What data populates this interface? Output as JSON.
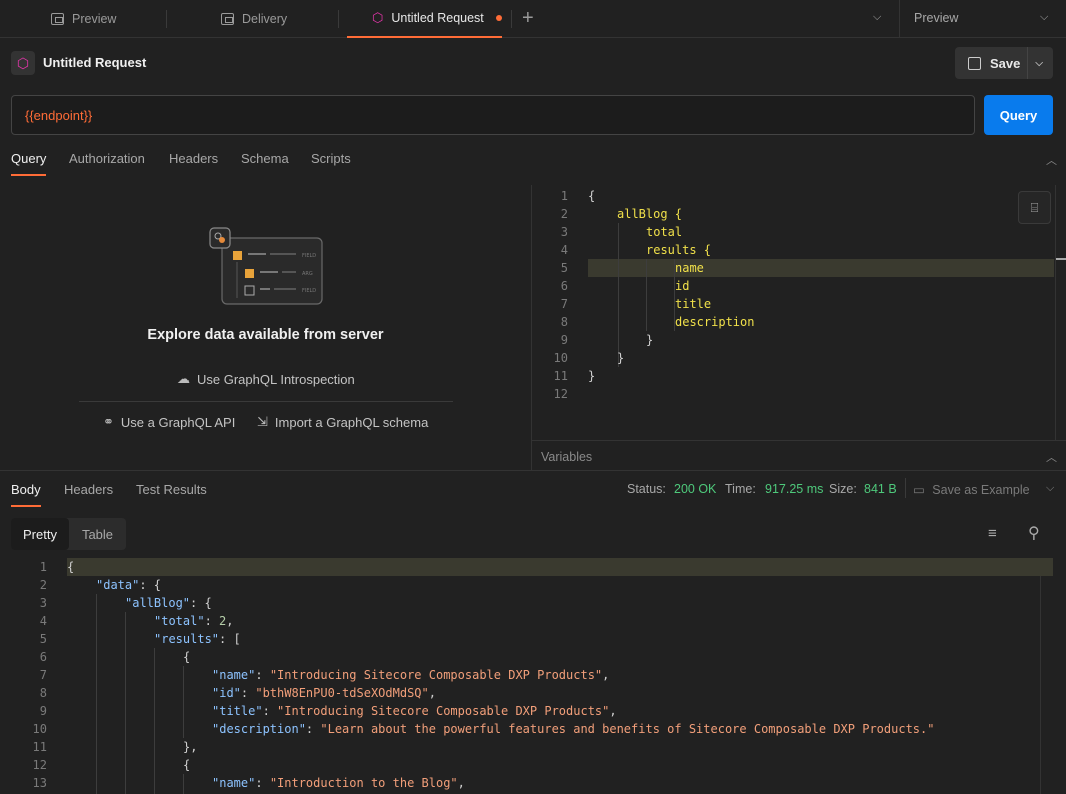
{
  "tabs": [
    {
      "label": "Preview",
      "icon": "request-icon"
    },
    {
      "label": "Delivery",
      "icon": "request-icon"
    },
    {
      "label": "Untitled Request",
      "icon": "graphql-icon",
      "active": true,
      "unsaved": true
    }
  ],
  "env_selector": "Preview",
  "request": {
    "title": "Untitled Request",
    "save_label": "Save",
    "url": "{{endpoint}}",
    "query_button": "Query",
    "subtabs": [
      "Query",
      "Authorization",
      "Headers",
      "Schema",
      "Scripts"
    ]
  },
  "explore": {
    "title": "Explore data available from server",
    "introspection": "Use GraphQL Introspection",
    "use_api": "Use a GraphQL API",
    "import_schema": "Import a GraphQL schema",
    "illus_labels": [
      "FIELD",
      "ARG",
      "FIELD"
    ]
  },
  "query_editor": {
    "line_numbers": [
      "1",
      "2",
      "3",
      "4",
      "5",
      "6",
      "7",
      "8",
      "9",
      "10",
      "11",
      "12"
    ],
    "lines": [
      {
        "text": "{"
      },
      {
        "text": "allBlog {"
      },
      {
        "text": "total"
      },
      {
        "text": "results {"
      },
      {
        "text": "name"
      },
      {
        "text": "id"
      },
      {
        "text": "title"
      },
      {
        "text": "description"
      },
      {
        "text": "}"
      },
      {
        "text": "}"
      },
      {
        "text": "}"
      },
      {
        "text": ""
      }
    ]
  },
  "variables_label": "Variables",
  "response": {
    "tabs": [
      "Body",
      "Headers",
      "Test Results"
    ],
    "status_label": "Status:",
    "status_value": "200 OK",
    "time_label": "Time:",
    "time_value": "917.25 ms",
    "size_label": "Size:",
    "size_value": "841 B",
    "save_example": "Save as Example",
    "views": [
      "Pretty",
      "Table"
    ],
    "line_numbers": [
      "1",
      "2",
      "3",
      "4",
      "5",
      "6",
      "7",
      "8",
      "9",
      "10",
      "11",
      "12",
      "13"
    ],
    "json": {
      "l1": "{",
      "data_key": "\"data\"",
      "allblog_key": "\"allBlog\"",
      "total_key": "\"total\"",
      "total_val": "2",
      "results_key": "\"results\"",
      "name_key": "\"name\"",
      "id_key": "\"id\"",
      "title_key": "\"title\"",
      "desc_key": "\"description\"",
      "r1_name": "\"Introducing Sitecore Composable DXP Products\"",
      "r1_id": "\"bthW8EnPU0-tdSeXOdMdSQ\"",
      "r1_title": "\"Introducing Sitecore Composable DXP Products\"",
      "r1_desc": "\"Learn about the powerful features and benefits of Sitecore Composable DXP Products.\"",
      "r2_name": "\"Introduction to the Blog\""
    }
  },
  "colors": {
    "accent": "#ff6c37",
    "primary": "#097bed",
    "success": "#4ec97b"
  }
}
